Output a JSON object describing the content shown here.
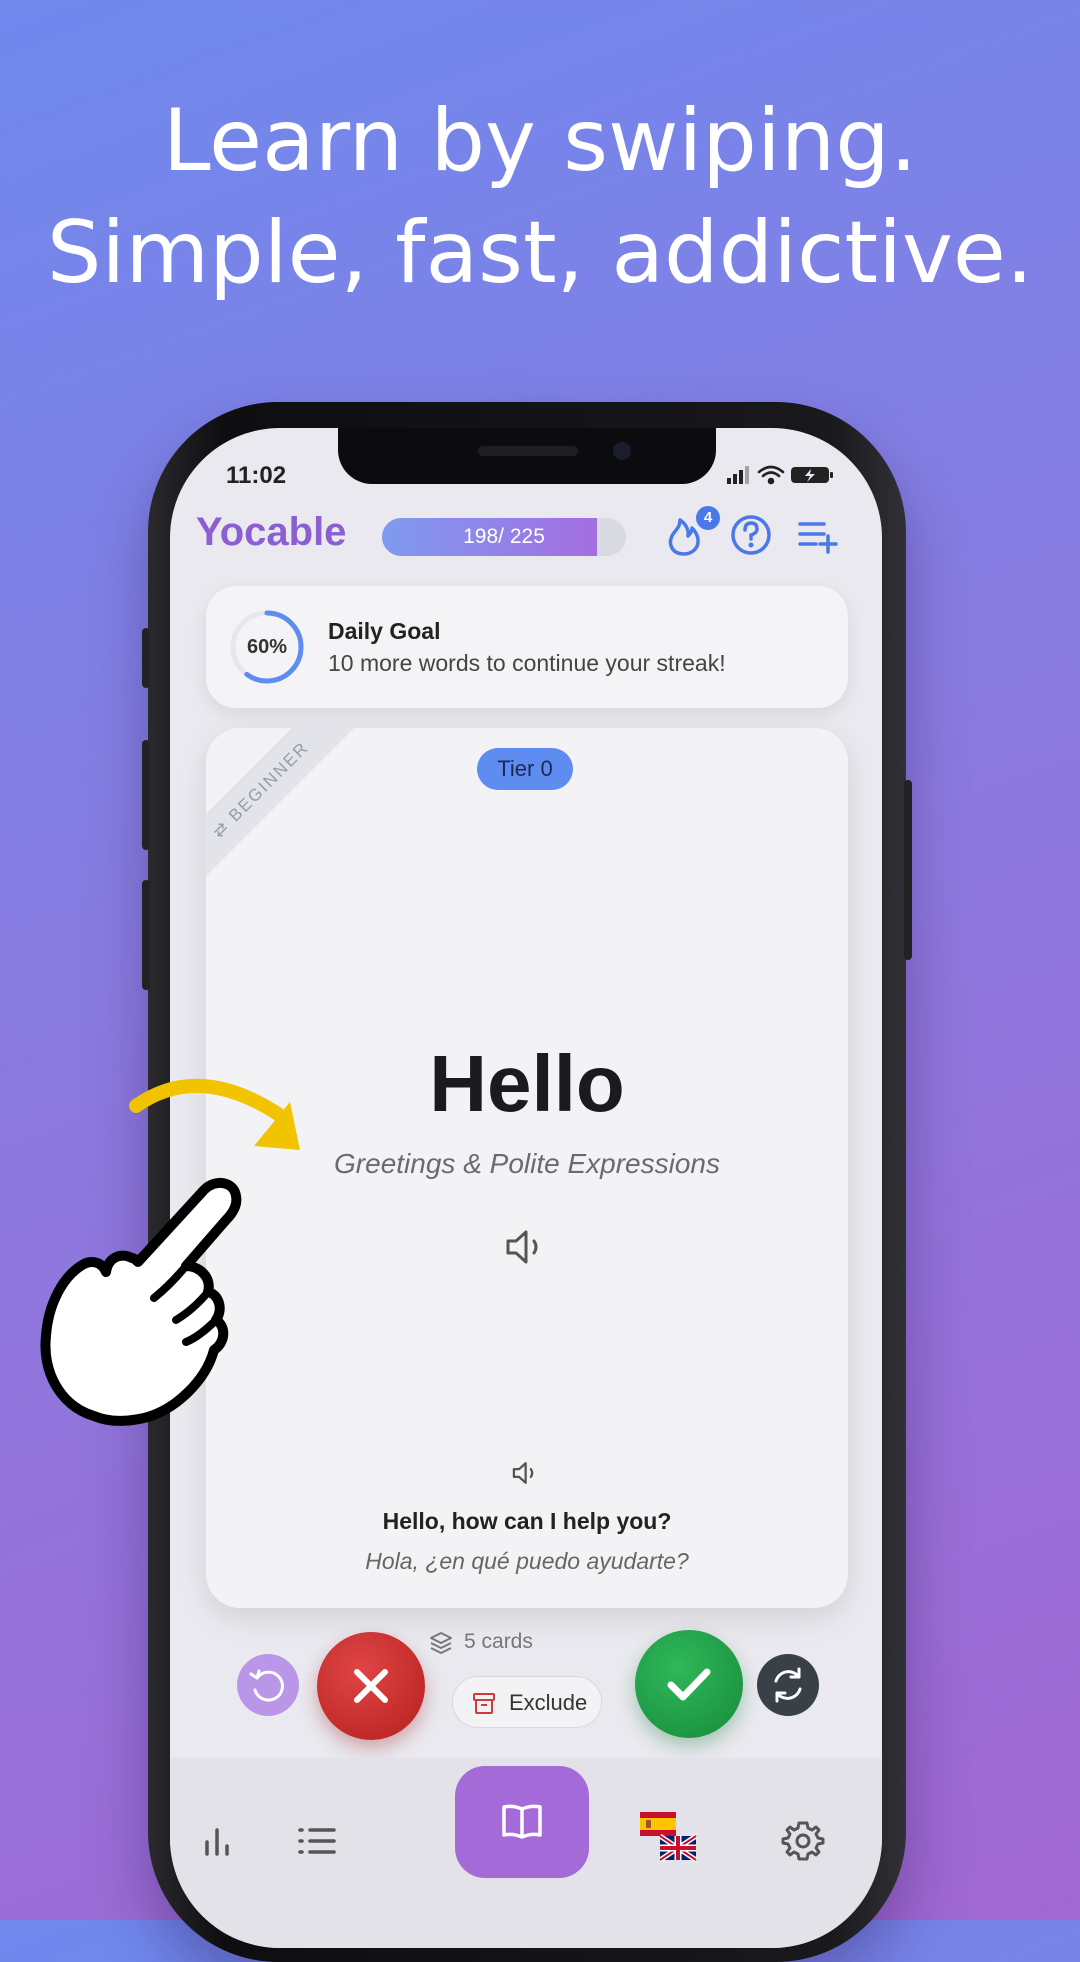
{
  "headline": {
    "line1": "Learn by swiping.",
    "line2": "Simple, fast, addictive."
  },
  "status_bar": {
    "time": "11:02"
  },
  "header": {
    "logo": "Yocable",
    "progress_text": "198/ 225",
    "progress_fraction": 0.88,
    "streak_badge": "4",
    "icons": [
      "fire-icon",
      "help-icon",
      "playlist-add-icon"
    ]
  },
  "daily_goal": {
    "percent_label": "60%",
    "percent": 60,
    "title": "Daily Goal",
    "subtitle": "10 more words to continue your streak!"
  },
  "card": {
    "tier": "Tier 0",
    "level_ribbon": "BEGINNER",
    "word": "Hello",
    "category": "Greetings & Polite Expressions",
    "example": "Hello, how can I help you?",
    "example_translation": "Hola, ¿en qué puedo ayudarte?"
  },
  "deck": {
    "cards_label": "5 cards",
    "exclude_label": "Exclude"
  },
  "nav": {
    "items": [
      "stats-icon",
      "list-icon",
      "book-icon",
      "language-flags",
      "settings-icon"
    ]
  },
  "colors": {
    "brand": "#8b5fcf",
    "accent": "#5e8cf0",
    "no": "#c62828",
    "yes": "#1e9b45",
    "nav_active": "#a46ad8"
  }
}
